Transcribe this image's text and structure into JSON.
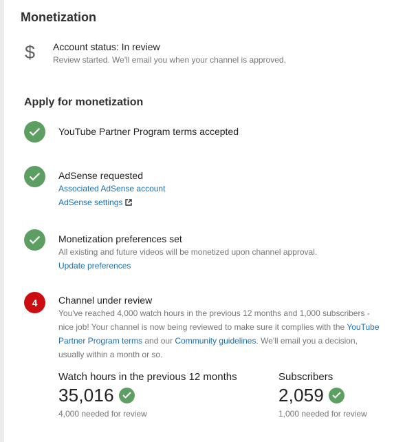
{
  "section": {
    "title": "Monetization"
  },
  "account_status": {
    "icon": "dollar-sign-icon",
    "title": "Account status: In review",
    "subtitle": "Review started. We'll email you when your channel is approved."
  },
  "apply": {
    "title": "Apply for monetization",
    "steps": [
      {
        "status": "done",
        "title": "YouTube Partner Program terms accepted"
      },
      {
        "status": "done",
        "title": "AdSense requested",
        "links": [
          "Associated AdSense account",
          "AdSense settings"
        ]
      },
      {
        "status": "done",
        "title": "Monetization preferences set",
        "desc": "All existing and future videos will be monetized upon channel approval.",
        "links": [
          "Update preferences"
        ]
      },
      {
        "status": "pending",
        "number": "4",
        "title": "Channel under review",
        "desc_part1": "You've reached 4,000 watch hours in the previous 12 months and 1,000 subscribers - nice job! Your channel is now being reviewed to make sure it complies with the ",
        "link1": "YouTube Partner Program terms",
        "desc_part2": " and our ",
        "link2": "Community guidelines",
        "desc_part3": ". We'll email you a decision, usually within a month or so."
      }
    ]
  },
  "stats": {
    "watch_hours": {
      "label": "Watch hours in the previous 12 months",
      "value": "35,016",
      "sub": "4,000 needed for review"
    },
    "subscribers": {
      "label": "Subscribers",
      "value": "2,059",
      "sub": "1,000 needed for review"
    }
  },
  "colors": {
    "success": "#5d9f63",
    "alert": "#cc0e12",
    "link": "#1a6fb5",
    "muted": "#757575"
  }
}
